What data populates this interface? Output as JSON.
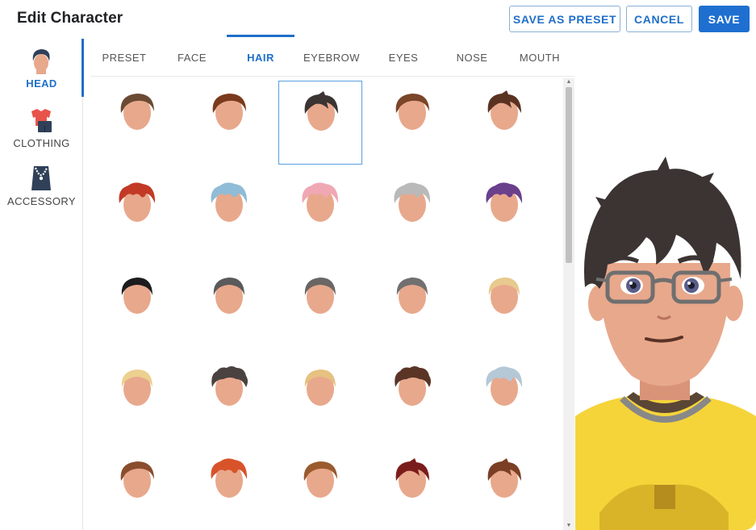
{
  "header": {
    "title": "Edit Character",
    "save_preset_label": "SAVE AS PRESET",
    "cancel_label": "CANCEL",
    "save_label": "SAVE"
  },
  "sidebar": {
    "items": [
      {
        "label": "HEAD",
        "icon": "head-icon",
        "active": true
      },
      {
        "label": "CLOTHING",
        "icon": "clothing-icon",
        "active": false
      },
      {
        "label": "ACCESSORY",
        "icon": "necklace-icon",
        "active": false
      }
    ]
  },
  "tabs": [
    {
      "label": "PRESET",
      "active": false
    },
    {
      "label": "FACE",
      "active": false
    },
    {
      "label": "HAIR",
      "active": true
    },
    {
      "label": "EYEBROW",
      "active": false
    },
    {
      "label": "EYES",
      "active": false
    },
    {
      "label": "NOSE",
      "active": false
    },
    {
      "label": "MOUTH",
      "active": false
    }
  ],
  "hair_options": [
    {
      "style": "side",
      "color": "#6b4a34",
      "selected": false
    },
    {
      "style": "side",
      "color": "#7a3a1c",
      "selected": false
    },
    {
      "style": "messy",
      "color": "#3b3433",
      "selected": true
    },
    {
      "style": "side",
      "color": "#7a4528",
      "selected": false
    },
    {
      "style": "messy",
      "color": "#5a3222",
      "selected": false
    },
    {
      "style": "fluffy",
      "color": "#c23a25",
      "selected": false
    },
    {
      "style": "fluffy",
      "color": "#8fbcd6",
      "selected": false
    },
    {
      "style": "fluffy",
      "color": "#f0a8b4",
      "selected": false
    },
    {
      "style": "fluffy",
      "color": "#b9b9b9",
      "selected": false
    },
    {
      "style": "fluffy",
      "color": "#6a3f8c",
      "selected": false
    },
    {
      "style": "short",
      "color": "#1c1c1e",
      "selected": false
    },
    {
      "style": "short",
      "color": "#5a5a5c",
      "selected": false
    },
    {
      "style": "short",
      "color": "#6a6664",
      "selected": false
    },
    {
      "style": "short",
      "color": "#707070",
      "selected": false
    },
    {
      "style": "short",
      "color": "#e8c98e",
      "selected": false
    },
    {
      "style": "short",
      "color": "#ecd08f",
      "selected": false
    },
    {
      "style": "curly",
      "color": "#4a4240",
      "selected": false
    },
    {
      "style": "short",
      "color": "#e6c181",
      "selected": false
    },
    {
      "style": "curly",
      "color": "#5a3526",
      "selected": false
    },
    {
      "style": "fluffy",
      "color": "#b4c8d6",
      "selected": false
    },
    {
      "style": "side",
      "color": "#8a4e2e",
      "selected": false
    },
    {
      "style": "fluffy",
      "color": "#d9532a",
      "selected": false
    },
    {
      "style": "side",
      "color": "#9a5a2e",
      "selected": false
    },
    {
      "style": "messy",
      "color": "#7a1c1c",
      "selected": false
    },
    {
      "style": "messy",
      "color": "#7a3f24",
      "selected": false
    }
  ],
  "preview": {
    "hair_color": "#3b3433",
    "skin_color": "#e8a88c",
    "shirt_color": "#f5d43a",
    "glasses_color": "#6f6f6f"
  }
}
